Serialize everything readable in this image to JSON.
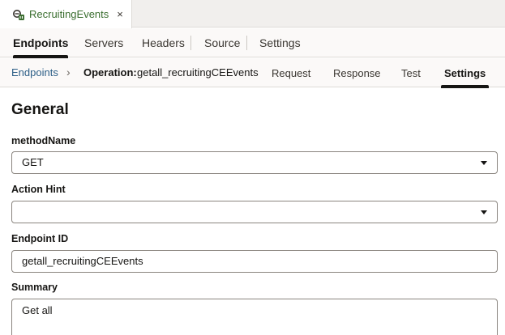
{
  "file_tab": {
    "name": "RecruitingEvents",
    "close_glyph": "×",
    "icon": "service-connection-icon",
    "icon_color": "#3a6e2f"
  },
  "primary_tabs": [
    {
      "label": "Endpoints",
      "active": true
    },
    {
      "label": "Servers",
      "active": false
    },
    {
      "label": "Headers",
      "active": false
    },
    {
      "label": "Source",
      "active": false
    },
    {
      "label": "Settings",
      "active": false
    }
  ],
  "secondary": {
    "breadcrumb": "Endpoints",
    "separator": "›",
    "operation_label": "Operation:",
    "operation_value": "getall_recruitingCEEvents",
    "tabs": [
      {
        "label": "Request",
        "active": false
      },
      {
        "label": "Response",
        "active": false
      },
      {
        "label": "Test",
        "active": false
      },
      {
        "label": "Settings",
        "active": true
      }
    ]
  },
  "form": {
    "heading": "General",
    "method_name": {
      "label": "methodName",
      "value": "GET"
    },
    "action_hint": {
      "label": "Action Hint",
      "value": ""
    },
    "endpoint_id": {
      "label": "Endpoint ID",
      "value": "getall_recruitingCEEvents"
    },
    "summary": {
      "label": "Summary",
      "value": "Get all"
    }
  },
  "colors": {
    "link": "#2d5f87",
    "active_indicator": "#161513"
  }
}
